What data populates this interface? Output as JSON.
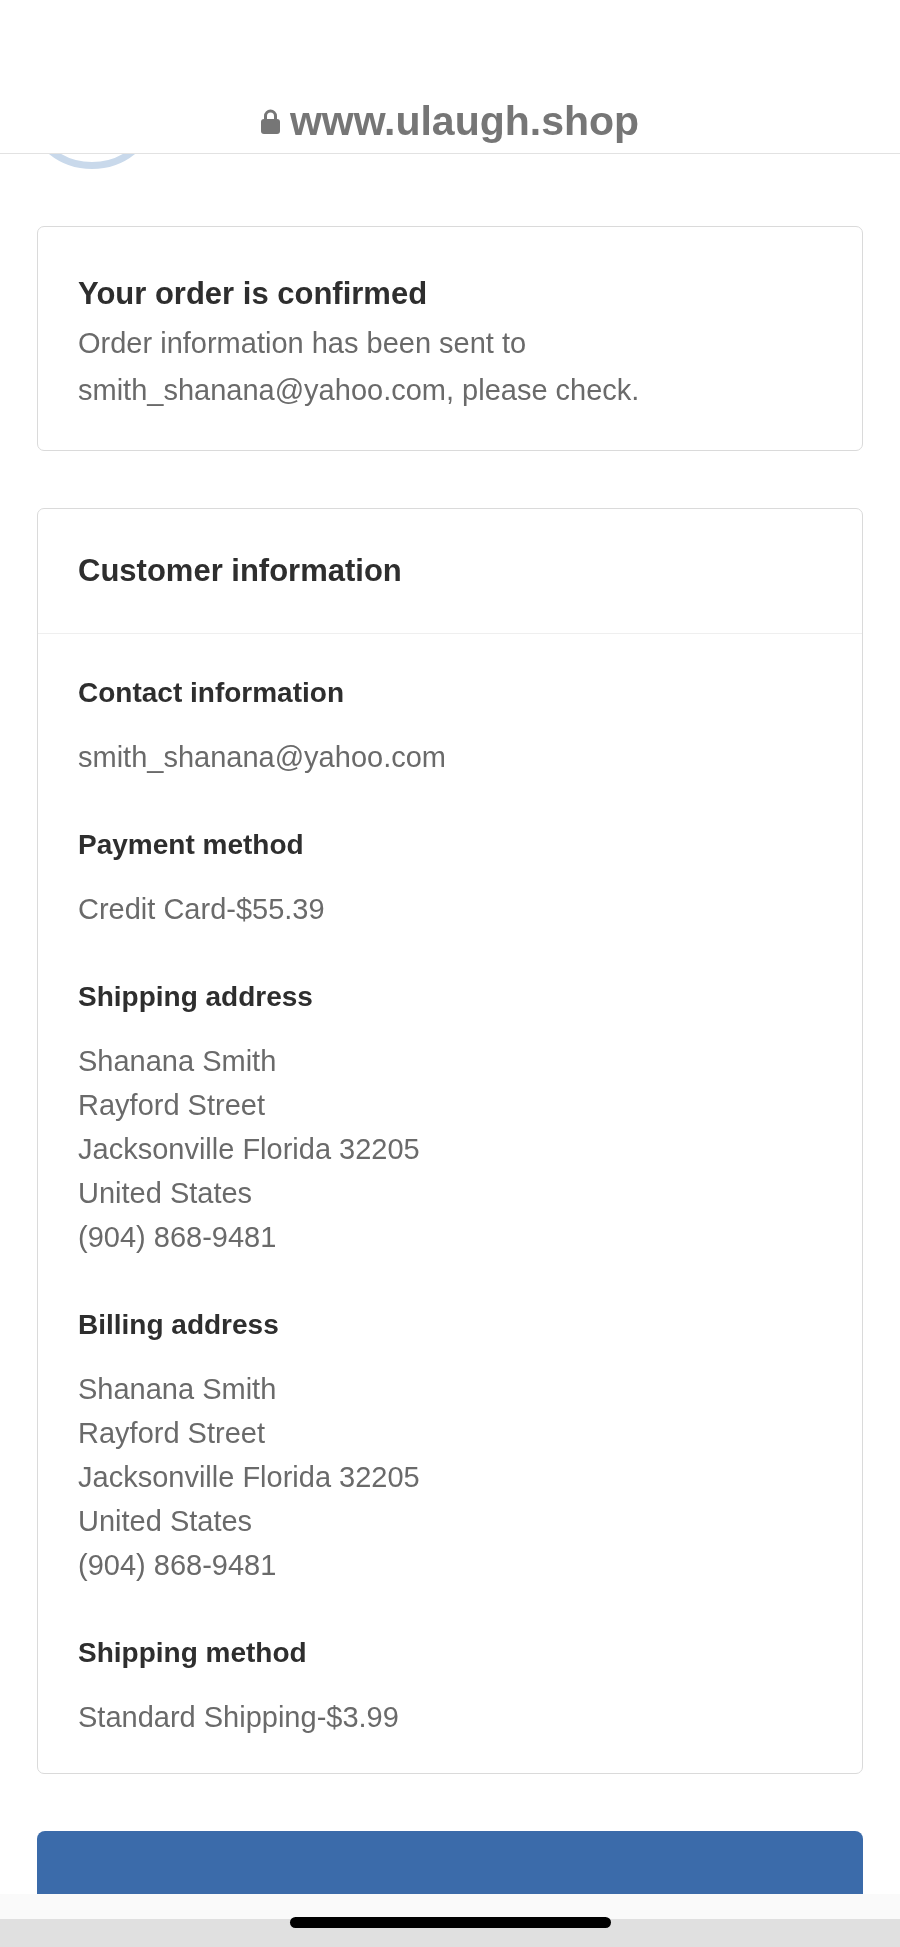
{
  "browser_bar": {
    "url": "www.ulaugh.shop"
  },
  "confirmation": {
    "title": "Your order is confirmed",
    "message": "Order information has been sent to smith_shanana@yahoo.com, please check."
  },
  "customer_information": {
    "title": "Customer information",
    "sections": [
      {
        "heading": "Contact information",
        "lines": [
          "smith_shanana@yahoo.com"
        ]
      },
      {
        "heading": "Payment method",
        "lines": [
          "Credit Card-$55.39"
        ]
      },
      {
        "heading": "Shipping address",
        "lines": [
          "Shanana Smith",
          "Rayford Street",
          "Jacksonville Florida 32205",
          "United States",
          "(904) 868-9481"
        ]
      },
      {
        "heading": "Billing address",
        "lines": [
          "Shanana Smith",
          "Rayford Street",
          "Jacksonville Florida 32205",
          "United States",
          "(904) 868-9481"
        ]
      },
      {
        "heading": "Shipping method",
        "lines": [
          "Standard Shipping-$3.99"
        ]
      }
    ]
  }
}
